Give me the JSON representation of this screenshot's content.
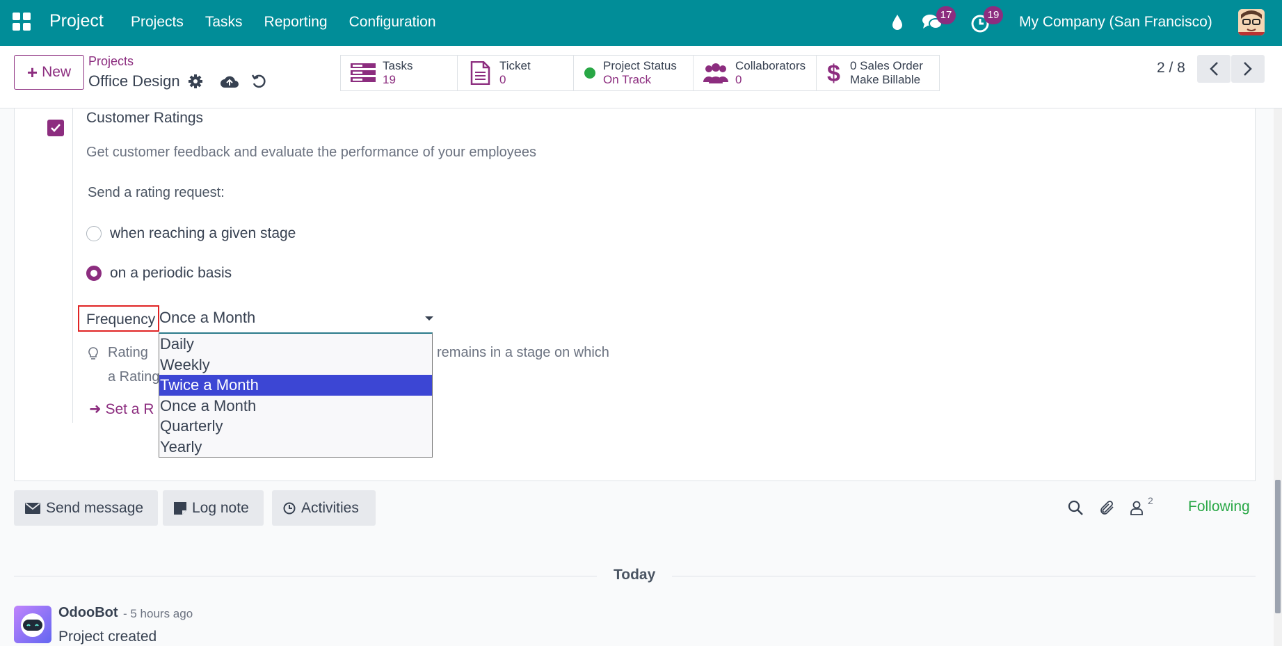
{
  "navbar": {
    "brand": "Project",
    "menu": [
      "Projects",
      "Tasks",
      "Reporting",
      "Configuration"
    ],
    "chat_badge": "17",
    "activity_badge": "19",
    "company": "My Company (San Francisco)",
    "color": "#018d98"
  },
  "control": {
    "new_label": "New",
    "breadcrumb_parent": "Projects",
    "breadcrumb_current": "Office Design",
    "stats": [
      {
        "label": "Tasks",
        "value": "19",
        "icon": "tasks-icon"
      },
      {
        "label": "Ticket",
        "value": "0",
        "icon": "document-icon"
      },
      {
        "label": "Project Status",
        "value": "On Track",
        "icon": "status-dot-icon"
      },
      {
        "label": "Collaborators",
        "value": "0",
        "icon": "users-icon"
      },
      {
        "label": "0 Sales Order",
        "value": "Make Billable",
        "icon": "dollar-icon"
      }
    ],
    "pager": "2 / 8"
  },
  "form": {
    "setting_title": "Customer Ratings",
    "setting_description": "Get customer feedback and evaluate the performance of your employees",
    "rating_request_label": "Send a rating request:",
    "radio_options": [
      {
        "label": "when reaching a given stage",
        "checked": false
      },
      {
        "label": "on a periodic basis",
        "checked": true
      }
    ],
    "frequency_label": "Frequency",
    "frequency_value": "Once a Month",
    "frequency_options": [
      "Daily",
      "Weekly",
      "Twice a Month",
      "Once a Month",
      "Quarterly",
      "Yearly"
    ],
    "highlighted_option": "Twice a Month",
    "hint_start": "Rating",
    "hint_end": "remains in a stage on which",
    "hint_line2": "a Rating",
    "set_link": "Set a R"
  },
  "chatter": {
    "send_message": "Send message",
    "log_note": "Log note",
    "activities": "Activities",
    "follower_count": "2",
    "following": "Following",
    "date_separator": "Today",
    "message": {
      "author": "OdooBot",
      "time": "- 5 hours ago",
      "body": "Project created"
    }
  },
  "colors": {
    "accent": "#8c2d7f",
    "highlight": "#3c46d4",
    "following": "#28a745",
    "frequency_outline": "#e02424"
  }
}
